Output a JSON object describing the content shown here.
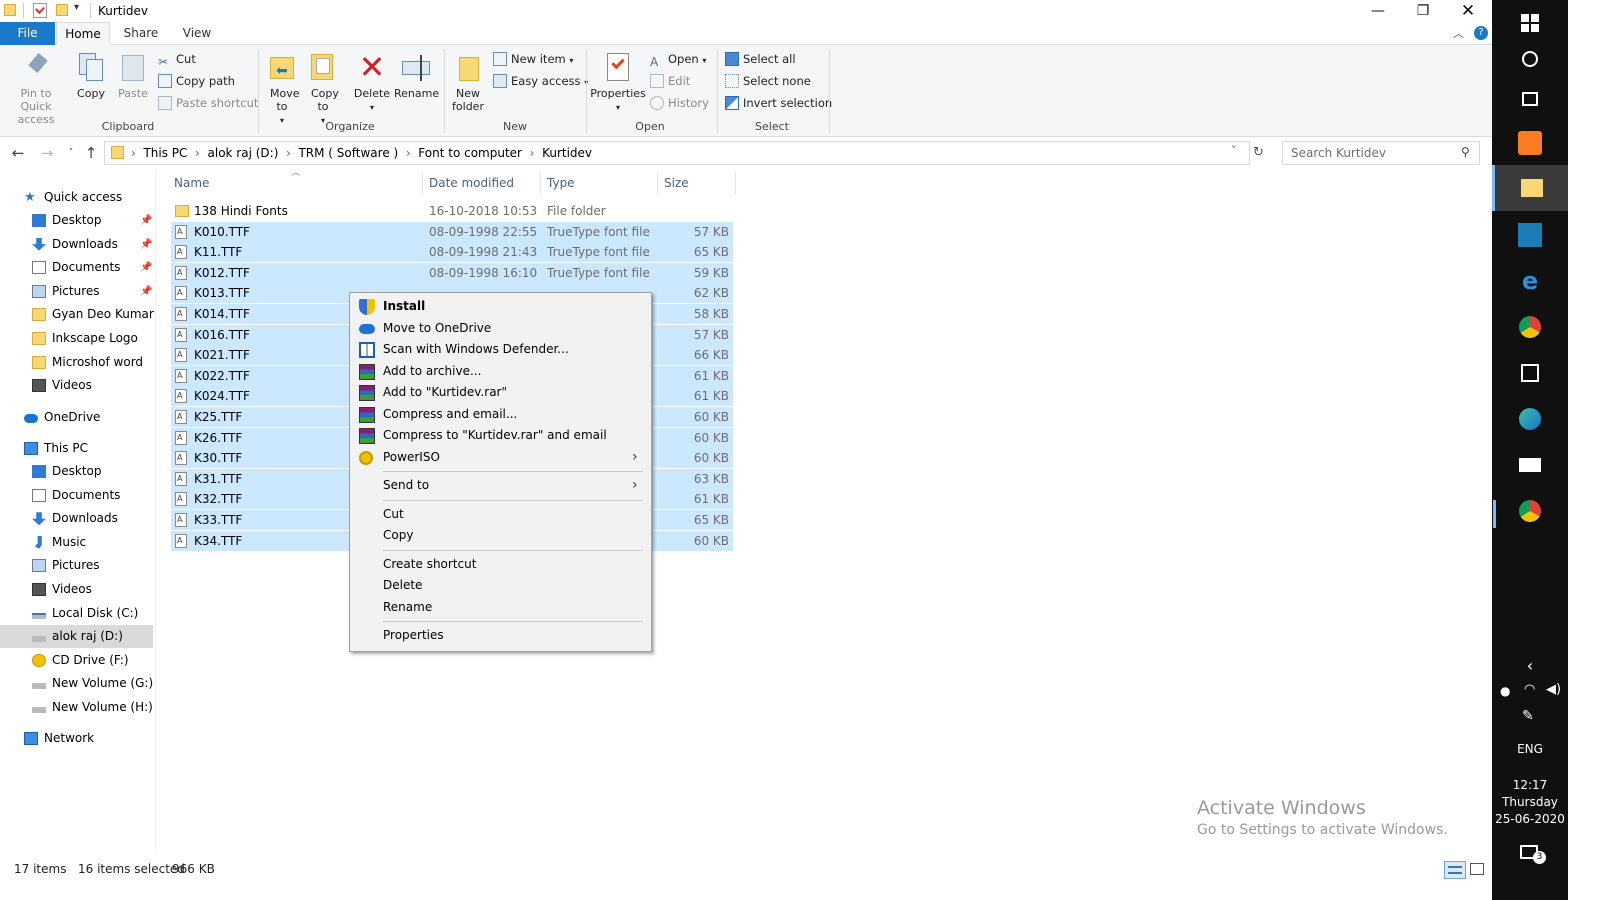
{
  "window": {
    "title": "Kurtidev"
  },
  "ribbon_tabs": [
    "File",
    "Home",
    "Share",
    "View"
  ],
  "ribbon": {
    "clipboard": {
      "label": "Clipboard",
      "pin": "Pin to Quick access",
      "copy": "Copy",
      "paste": "Paste",
      "cut": "Cut",
      "copy_path": "Copy path",
      "paste_shortcut": "Paste shortcut"
    },
    "organize": {
      "label": "Organize",
      "move_to": "Move to",
      "copy_to": "Copy to",
      "delete": "Delete",
      "rename": "Rename"
    },
    "new": {
      "label": "New",
      "new_folder": "New folder",
      "new_item": "New item",
      "easy_access": "Easy access"
    },
    "open": {
      "label": "Open",
      "properties": "Properties",
      "open": "Open",
      "edit": "Edit",
      "history": "History"
    },
    "select": {
      "label": "Select",
      "select_all": "Select all",
      "select_none": "Select none",
      "invert": "Invert selection"
    }
  },
  "address": {
    "breadcrumb": [
      "This PC",
      "alok raj (D:)",
      "TRM ( Software )",
      "Font to computer",
      "Kurtidev"
    ],
    "search_placeholder": "Search Kurtidev"
  },
  "nav": {
    "quick_access": "Quick access",
    "quick_items": [
      "Desktop",
      "Downloads",
      "Documents",
      "Pictures",
      "Gyan Deo Kumar ( P",
      "Inkscape Logo",
      "Microshof word",
      "Videos"
    ],
    "onedrive": "OneDrive",
    "this_pc": "This PC",
    "pc_items": [
      "Desktop",
      "Documents",
      "Downloads",
      "Music",
      "Pictures",
      "Videos",
      "Local Disk (C:)",
      "alok raj (D:)",
      "CD Drive (F:)",
      "New Volume (G:)",
      "New Volume (H:)"
    ],
    "network": "Network"
  },
  "columns": [
    "Name",
    "Date modified",
    "Type",
    "Size"
  ],
  "files": [
    {
      "name": "138 Hindi Fonts",
      "date": "16-10-2018 10:53",
      "type": "File folder",
      "size": ""
    },
    {
      "name": "K010.TTF",
      "date": "08-09-1998 22:55",
      "type": "TrueType font file",
      "size": "57 KB"
    },
    {
      "name": "K11.TTF",
      "date": "08-09-1998 21:43",
      "type": "TrueType font file",
      "size": "65 KB"
    },
    {
      "name": "K012.TTF",
      "date": "08-09-1998 16:10",
      "type": "TrueType font file",
      "size": "59 KB"
    },
    {
      "name": "K013.TTF",
      "date": "",
      "type": "",
      "size": "62 KB"
    },
    {
      "name": "K014.TTF",
      "date": "",
      "type": "",
      "size": "58 KB"
    },
    {
      "name": "K016.TTF",
      "date": "",
      "type": "",
      "size": "57 KB"
    },
    {
      "name": "K021.TTF",
      "date": "",
      "type": "",
      "size": "66 KB"
    },
    {
      "name": "K022.TTF",
      "date": "",
      "type": "",
      "size": "61 KB"
    },
    {
      "name": "K024.TTF",
      "date": "",
      "type": "",
      "size": "61 KB"
    },
    {
      "name": "K25.TTF",
      "date": "",
      "type": "",
      "size": "60 KB"
    },
    {
      "name": "K26.TTF",
      "date": "",
      "type": "",
      "size": "60 KB"
    },
    {
      "name": "K30.TTF",
      "date": "",
      "type": "",
      "size": "60 KB"
    },
    {
      "name": "K31.TTF",
      "date": "",
      "type": "",
      "size": "63 KB"
    },
    {
      "name": "K32.TTF",
      "date": "",
      "type": "",
      "size": "61 KB"
    },
    {
      "name": "K33.TTF",
      "date": "",
      "type": "",
      "size": "65 KB"
    },
    {
      "name": "K34.TTF",
      "date": "",
      "type": "",
      "size": "60 KB"
    }
  ],
  "context_menu": {
    "install": "Install",
    "onedrive": "Move to OneDrive",
    "defender": "Scan with Windows Defender...",
    "add_archive": "Add to archive...",
    "add_rar": "Add to \"Kurtidev.rar\"",
    "compress_email": "Compress and email...",
    "compress_rar_email": "Compress to \"Kurtidev.rar\" and email",
    "poweriso": "PowerISO",
    "send_to": "Send to",
    "cut": "Cut",
    "copy": "Copy",
    "create_shortcut": "Create shortcut",
    "delete": "Delete",
    "rename": "Rename",
    "properties": "Properties"
  },
  "status": {
    "items": "17 items",
    "selected": "16 items selected",
    "size": "966 KB"
  },
  "watermark": {
    "line1": "Activate Windows",
    "line2": "Go to Settings to activate Windows."
  },
  "taskbar": {
    "lang": "ENG",
    "time": "12:17",
    "day": "Thursday",
    "date": "25-06-2020",
    "notif_count": "3"
  },
  "colors": {
    "accent": "#1979ca",
    "selection": "#cce8ff",
    "folder": "#f8d775",
    "taskbar": "#101010"
  }
}
